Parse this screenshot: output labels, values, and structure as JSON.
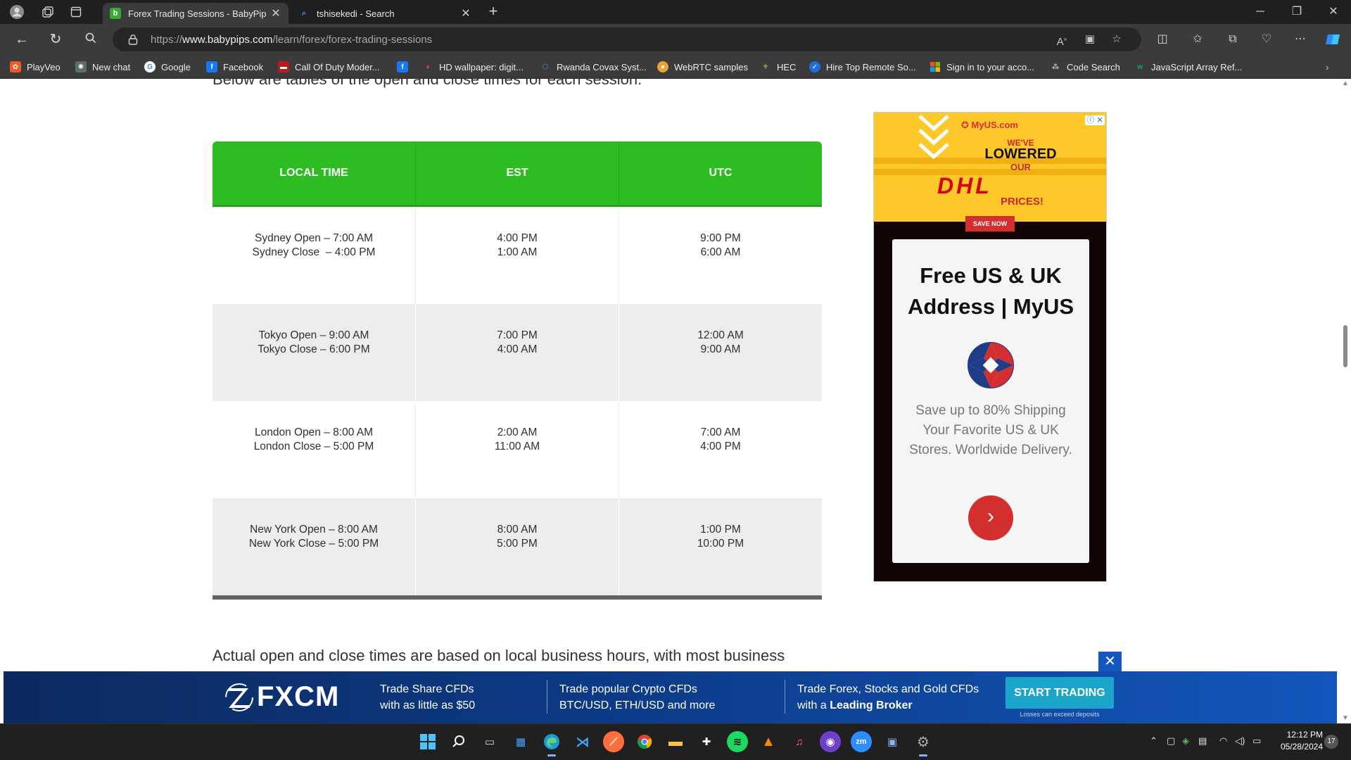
{
  "browser": {
    "tabs": [
      {
        "title": "Forex Trading Sessions - BabyPip",
        "favicon": "babypips-icon",
        "active": true
      },
      {
        "title": "tshisekedi - Search",
        "favicon": "bing-search-icon",
        "active": false
      }
    ],
    "url_prefix": "https://",
    "url_domain": "www.babypips.com",
    "url_path": "/learn/forex/forex-trading-sessions",
    "bookmarks": [
      {
        "label": "PlayVeo",
        "icon": "playveo-icon"
      },
      {
        "label": "New chat",
        "icon": "chatgpt-icon"
      },
      {
        "label": "Google",
        "icon": "google-icon"
      },
      {
        "label": "Facebook",
        "icon": "facebook-icon"
      },
      {
        "label": "Call Of Duty Moder...",
        "icon": "cod-icon"
      },
      {
        "label": "",
        "icon": "facebook-icon"
      },
      {
        "label": "HD wallpaper: digit...",
        "icon": "wallpaper-icon"
      },
      {
        "label": "Rwanda Covax Syst...",
        "icon": "covax-icon"
      },
      {
        "label": "WebRTC samples",
        "icon": "webrtc-icon"
      },
      {
        "label": "HEC",
        "icon": "hec-icon"
      },
      {
        "label": "Hire Top Remote So...",
        "icon": "remote-icon"
      },
      {
        "label": "Sign in to your acco...",
        "icon": "microsoft-icon"
      },
      {
        "label": "Code Search",
        "icon": "code-search-icon"
      },
      {
        "label": "JavaScript Array Ref...",
        "icon": "w3schools-icon"
      }
    ]
  },
  "article": {
    "intro": "Below are tables of the open and close times for each session.",
    "outro": "Actual open and close times are based on local business hours, with most business"
  },
  "sessions_table": {
    "headers": [
      "LOCAL TIME",
      "EST",
      "UTC"
    ],
    "rows": [
      {
        "local": [
          "Sydney Open – 7:00 AM",
          "Sydney Close  – 4:00 PM"
        ],
        "est": [
          "4:00 PM",
          "1:00 AM"
        ],
        "utc": [
          "9:00 PM",
          "6:00 AM"
        ]
      },
      {
        "local": [
          "Tokyo Open – 9:00 AM",
          "Tokyo Close – 6:00 PM"
        ],
        "est": [
          "7:00 PM",
          "4:00 AM"
        ],
        "utc": [
          "12:00 AM",
          "9:00 AM"
        ]
      },
      {
        "local": [
          "London Open – 8:00 AM",
          "London Close – 5:00 PM"
        ],
        "est": [
          "2:00 AM",
          "11:00 AM"
        ],
        "utc": [
          "7:00 AM",
          "4:00 PM"
        ]
      },
      {
        "local": [
          "New York Open – 8:00 AM",
          "New York Close – 5:00 PM"
        ],
        "est": [
          "8:00 AM",
          "5:00 PM"
        ],
        "utc": [
          "1:00 PM",
          "10:00 PM"
        ]
      }
    ],
    "header_color": "#2dbd23"
  },
  "side_ad": {
    "brand": "MyUS.com",
    "line1": "WE'VE",
    "line2": "LOWERED",
    "line3": "OUR",
    "carrier": "DHL",
    "line4": "PRICES!",
    "cta_small": "SAVE NOW",
    "title": "Free US & UK Address | MyUS",
    "body": "Save up to 80% Shipping Your Favorite US & UK Stores. Worldwide Delivery."
  },
  "bottom_ad": {
    "brand": "FXCM",
    "promos": [
      {
        "line1": "Trade Share CFDs",
        "line2": "with as little as $50"
      },
      {
        "line1": "Trade popular Crypto CFDs",
        "line2": "BTC/USD, ETH/USD and more"
      },
      {
        "line1": "Trade Forex, Stocks and Gold CFDs",
        "line2_prefix": "with a ",
        "line2_bold": "Leading Broker"
      }
    ],
    "cta": "START TRADING",
    "disclaimer": "Losses can exceed deposits",
    "close": "✕"
  },
  "taskbar": {
    "time": "12:12 PM",
    "date": "05/28/2024",
    "notifications": "17"
  }
}
